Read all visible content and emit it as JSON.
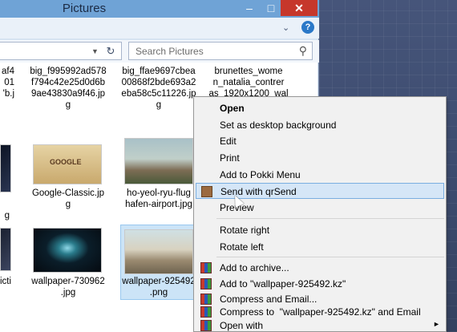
{
  "window": {
    "title": "Pictures"
  },
  "titlebar": {
    "minimize": "–",
    "maximize": "□",
    "close": "✕"
  },
  "search": {
    "placeholder": "Search Pictures"
  },
  "files": {
    "row1": [
      {
        "name": "af4\n01\n'b.j"
      },
      {
        "name": "big_f995992ad578\nf794c42e25d0d6b\n9ae43830a9f46.jp\ng"
      },
      {
        "name": "big_ffae9697cbea\n00868f2bde693a2\neba58c5c11226.jp\ng"
      },
      {
        "name": "brunettes_wome\nn_natalia_contrer\nas_1920x1200_wal"
      }
    ],
    "row2": [
      {
        "name": "g"
      },
      {
        "name": "Google-Classic.jp\ng"
      },
      {
        "name": "ho-yeol-ryu-flug\nhafen-airport.jpg"
      }
    ],
    "row3": [
      {
        "name": "icti"
      },
      {
        "name": "wallpaper-730962\n.jpg"
      },
      {
        "name": "wallpaper-925492\n.png"
      }
    ]
  },
  "thumb_text": {
    "google": "GOOGLE"
  },
  "context_menu": {
    "items": [
      {
        "label": "Open",
        "bold": true
      },
      {
        "label": "Set as desktop background"
      },
      {
        "label": "Edit"
      },
      {
        "label": "Print"
      },
      {
        "label": "Add to Pokki Menu"
      },
      {
        "label": "Send with qrSend",
        "highlighted": true,
        "icon": "qrsend-icon"
      },
      {
        "label": "Preview"
      },
      {
        "label": "Rotate right"
      },
      {
        "label": "Rotate left"
      },
      {
        "label": "Add to archive...",
        "icon": "winrar-icon"
      },
      {
        "label": "Add to \"wallpaper-925492.kz\"",
        "icon": "winrar-icon"
      },
      {
        "label": "Compress and Email...",
        "icon": "winrar-icon"
      },
      {
        "label": "Compress to  \"wallpaper-925492.kz\" and Email",
        "icon": "winrar-icon"
      },
      {
        "label": "Open with",
        "submenu_arrow": "►"
      }
    ]
  },
  "colors": {
    "title_bar": "#6fa3d6",
    "close_button": "#c6372b",
    "selection": "#cce4f7",
    "menu_highlight": "#d5e6f7"
  }
}
